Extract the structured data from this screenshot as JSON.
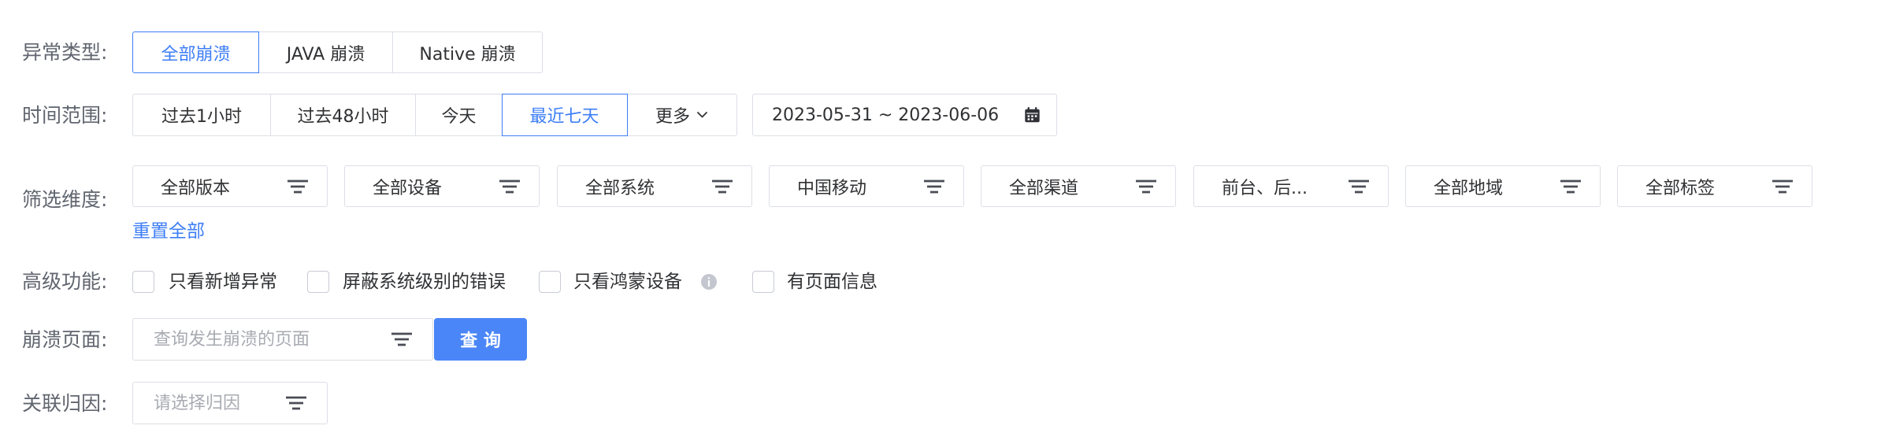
{
  "crash_type": {
    "label": "异常类型:",
    "options": [
      "全部崩溃",
      "JAVA 崩溃",
      "Native 崩溃"
    ],
    "selected": "全部崩溃"
  },
  "time_range": {
    "label": "时间范围:",
    "options": [
      "过去1小时",
      "过去48小时",
      "今天",
      "最近七天"
    ],
    "more_label": "更多",
    "more_icon": "chevron-down-icon",
    "selected": "最近七天",
    "date_range": "2023-05-31 ~ 2023-06-06",
    "date_icon": "calendar-icon"
  },
  "filter": {
    "label": "筛选维度:",
    "items": [
      "全部版本",
      "全部设备",
      "全部系统",
      "中国移动",
      "全部渠道",
      "前台、后...",
      "全部地域",
      "全部标签"
    ],
    "item_icon": "filter-icon",
    "reset_label": "重置全部"
  },
  "advanced": {
    "label": "高级功能:",
    "options": [
      {
        "label": "只看新增异常",
        "checked": false
      },
      {
        "label": "屏蔽系统级别的错误",
        "checked": false
      },
      {
        "label": "只看鸿蒙设备",
        "checked": false,
        "icon": "info-icon"
      },
      {
        "label": "有页面信息",
        "checked": false
      }
    ]
  },
  "crash_page": {
    "label": "崩溃页面:",
    "placeholder": "查询发生崩溃的页面",
    "icon": "filter-icon",
    "button_label": "查 询"
  },
  "attribution": {
    "label": "关联归因:",
    "placeholder": "请选择归因",
    "icon": "filter-icon"
  },
  "colors": {
    "accent": "#3d7ef6",
    "primary_button": "#4a86f7",
    "border": "#dcdfe6",
    "label": "#60656f",
    "text": "#303133",
    "placeholder": "#a8abb2"
  }
}
